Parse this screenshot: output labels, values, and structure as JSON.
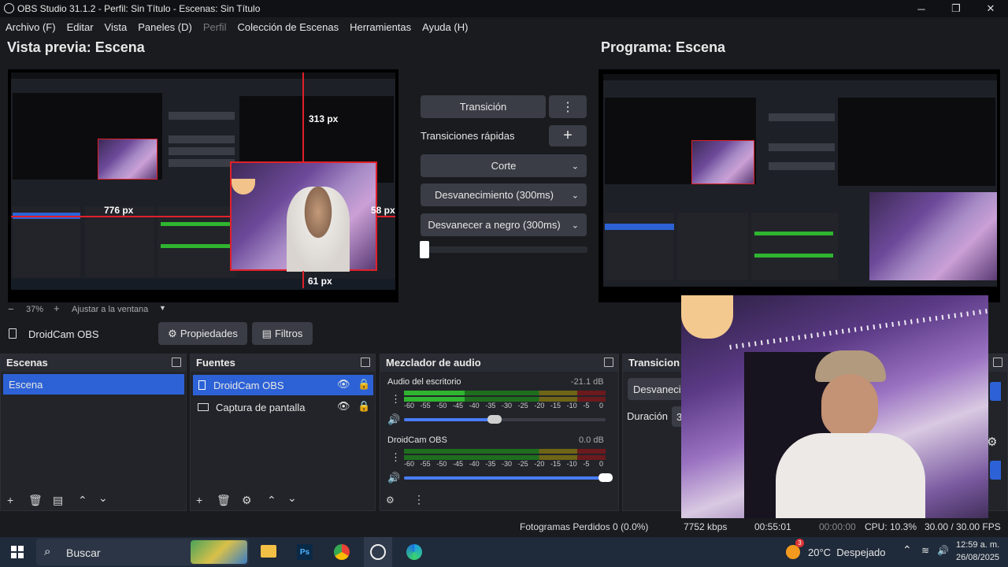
{
  "window": {
    "title": "OBS Studio 31.1.2 - Perfil: Sin Título - Escenas: Sin Título"
  },
  "menu": [
    "Archivo (F)",
    "Editar",
    "Vista",
    "Paneles (D)",
    "Perfil",
    "Colección de Escenas",
    "Herramientas",
    "Ayuda (H)"
  ],
  "preview": {
    "title": "Vista previa: Escena",
    "zoom": "37%",
    "fit": "Ajustar a la ventana",
    "dim_top": "313 px",
    "dim_left": "776 px",
    "dim_right": "58 px",
    "dim_bottom": "61 px"
  },
  "program": {
    "title": "Programa: Escena"
  },
  "transitions_panel": {
    "transition_button": "Transición",
    "quick_label": "Transiciones rápidas",
    "items": [
      "Corte",
      "Desvanecimiento (300ms)",
      "Desvanecer a negro (300ms)"
    ]
  },
  "source_toolbar": {
    "source_name": "DroidCam OBS",
    "properties": "Propiedades",
    "filters": "Filtros"
  },
  "scenes": {
    "title": "Escenas",
    "items": [
      "Escena"
    ]
  },
  "sources": {
    "title": "Fuentes",
    "items": [
      "DroidCam OBS",
      "Captura de pantalla"
    ]
  },
  "mixer": {
    "title": "Mezclador de audio",
    "channels": [
      {
        "name": "Audio del escritorio",
        "db": "-21.1 dB",
        "volume": 0.45
      },
      {
        "name": "DroidCam OBS",
        "db": "0.0 dB",
        "volume": 1.0
      }
    ],
    "ticks": [
      "-60",
      "-55",
      "-50",
      "-45",
      "-40",
      "-35",
      "-30",
      "-25",
      "-20",
      "-15",
      "-10",
      "-5",
      "0"
    ]
  },
  "transitions_dock": {
    "title": "Transicion",
    "select": "Desvanecin",
    "duration_label": "Duración",
    "duration_value": "3"
  },
  "status": {
    "dropped": "Fotogramas Perdidos 0 (0.0%)",
    "kbps": "7752 kbps",
    "rec_time": "00:55:01",
    "stream_time": "00:00:00",
    "cpu": "CPU: 10.3%",
    "fps": "30.00 / 30.00 FPS"
  },
  "taskbar": {
    "search": "Buscar",
    "weather": "20°C  Despejado",
    "time": "12:59 a. m.",
    "date": "26/08/2025",
    "badge": "3"
  },
  "colors": {
    "accent": "#2d62d6",
    "preview_border": "#e0202a",
    "meter_green": "#2fb52f",
    "meter_yellow": "#b7a022",
    "meter_red": "#a3262b"
  }
}
